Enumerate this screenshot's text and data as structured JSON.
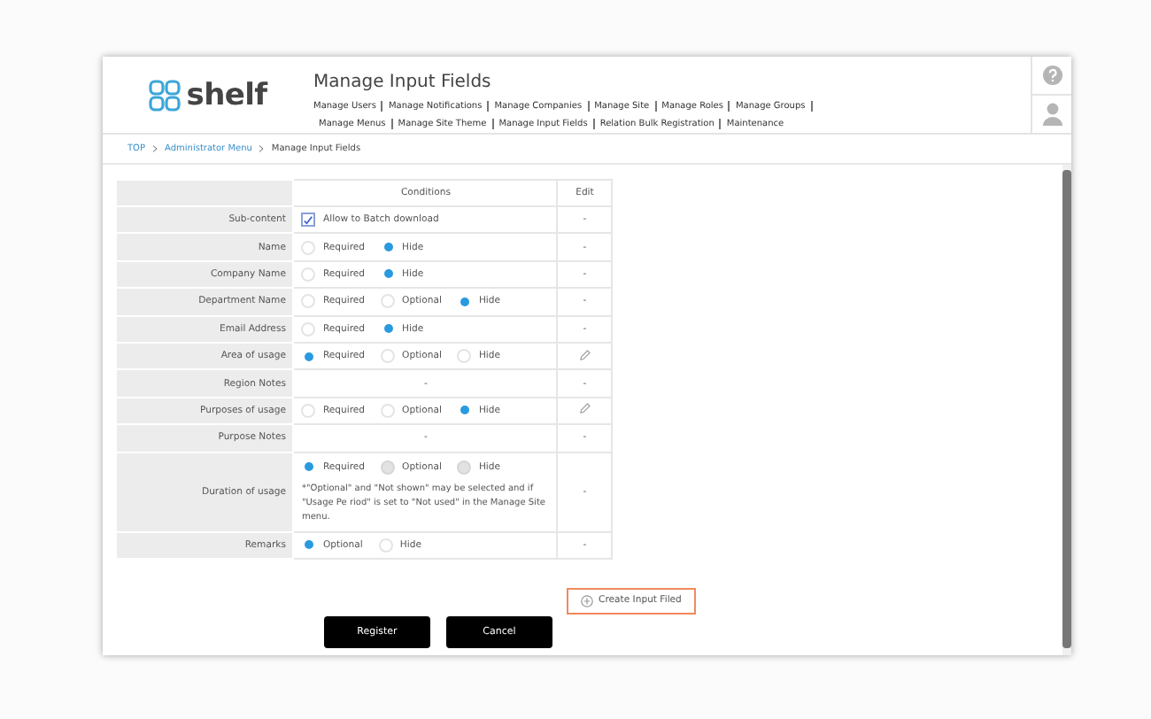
{
  "header": {
    "logo": "shelf",
    "title": "Manage Input Fields",
    "nav": [
      "Manage Users",
      "Manage Notifications",
      "Manage Companies",
      "Manage Site",
      "Manage Roles",
      "Manage Groups",
      "Manage Menus",
      "Manage Site Theme",
      "Manage Input Fields",
      "Relation Bulk Registration",
      "Maintenance"
    ]
  },
  "breadcrumb": [
    {
      "label": "TOP",
      "link": true
    },
    {
      "label": "Administrator Menu",
      "link": true
    },
    {
      "label": "Manage Input Fields",
      "link": false
    }
  ],
  "table": {
    "columns": [
      "Conditions",
      "Edit"
    ],
    "rows": [
      {
        "label": "Sub-content",
        "kind": "checkbox",
        "checkbox": {
          "label": "Allow to Batch download",
          "checked": true
        },
        "edit": "-"
      },
      {
        "label": "Name",
        "kind": "radio",
        "options": [
          {
            "label": "Required",
            "selected": false,
            "disabled": false
          },
          {
            "label": "Hide",
            "selected": true,
            "disabled": false
          }
        ],
        "edit": "-"
      },
      {
        "label": "Company Name",
        "kind": "radio",
        "options": [
          {
            "label": "Required",
            "selected": false,
            "disabled": false
          },
          {
            "label": "Hide",
            "selected": true,
            "disabled": false
          }
        ],
        "edit": "-"
      },
      {
        "label": "Department Name",
        "kind": "radio",
        "options": [
          {
            "label": "Required",
            "selected": false,
            "disabled": false
          },
          {
            "label": "Optional",
            "selected": false,
            "disabled": false
          },
          {
            "label": "Hide",
            "selected": true,
            "disabled": false
          }
        ],
        "edit": "-"
      },
      {
        "label": "Email Address",
        "kind": "radio",
        "options": [
          {
            "label": "Required",
            "selected": false,
            "disabled": false
          },
          {
            "label": "Hide",
            "selected": true,
            "disabled": false
          }
        ],
        "edit": "-"
      },
      {
        "label": "Area of usage",
        "kind": "radio",
        "options": [
          {
            "label": "Required",
            "selected": true,
            "disabled": false
          },
          {
            "label": "Optional",
            "selected": false,
            "disabled": false
          },
          {
            "label": "Hide",
            "selected": false,
            "disabled": false
          }
        ],
        "editable": true
      },
      {
        "label": "Region Notes",
        "kind": "text",
        "value": "-",
        "edit": "-"
      },
      {
        "label": "Purposes of usage",
        "kind": "radio",
        "options": [
          {
            "label": "Required",
            "selected": false,
            "disabled": false
          },
          {
            "label": "Optional",
            "selected": false,
            "disabled": false
          },
          {
            "label": "Hide",
            "selected": true,
            "disabled": false
          }
        ],
        "editable": true
      },
      {
        "label": "Purpose Notes",
        "kind": "text",
        "value": "-",
        "edit": "-"
      },
      {
        "label": "Duration of usage",
        "kind": "radio",
        "options": [
          {
            "label": "Required",
            "selected": true,
            "disabled": false
          },
          {
            "label": "Optional",
            "selected": false,
            "disabled": true
          },
          {
            "label": "Hide",
            "selected": false,
            "disabled": true
          }
        ],
        "note": "*\"Optional\" and \"Not shown\" may be selected and if \"Usage Pe riod\" is set to \"Not used\" in the Manage Site menu.",
        "edit": "-"
      },
      {
        "label": "Remarks",
        "kind": "radio",
        "options": [
          {
            "label": "Optional",
            "selected": true,
            "disabled": false
          },
          {
            "label": "Hide",
            "selected": false,
            "disabled": false
          }
        ],
        "edit": "-"
      }
    ]
  },
  "create_button": "Create Input Filed",
  "buttons": [
    "Register",
    "Cancel"
  ]
}
